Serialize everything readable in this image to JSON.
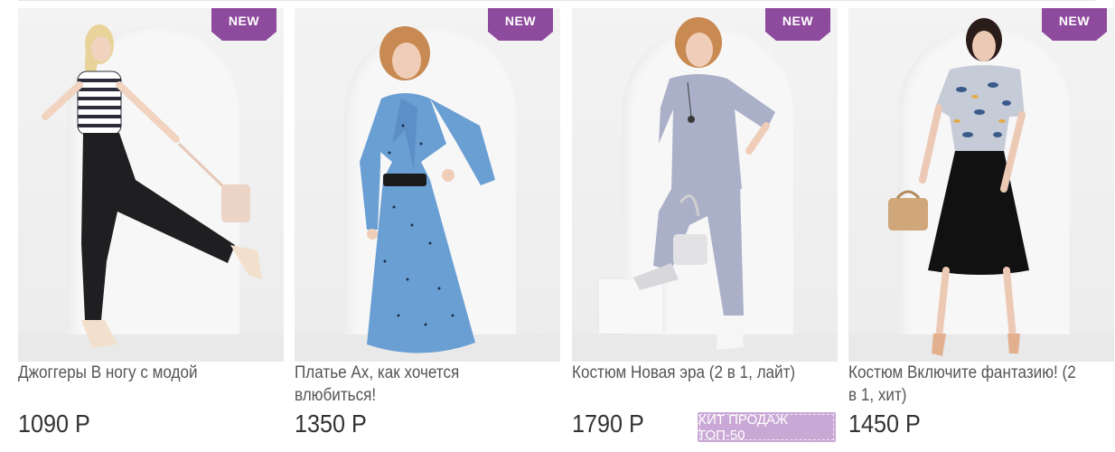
{
  "products": [
    {
      "badge": "NEW",
      "title": "Джоггеры В ногу с модой",
      "price": "1090 Р",
      "image_desc": "model-in-black-joggers-striped-top"
    },
    {
      "badge": "NEW",
      "title": "Платье Ах, как хочется влюбиться!",
      "price": "1350 Р",
      "image_desc": "model-in-blue-polka-dot-dress"
    },
    {
      "badge": "NEW",
      "title": "Костюм Новая эра (2 в 1, лайт)",
      "price": "1790 Р",
      "hit_badge": "ХИТ ПРОДАЖ ТОП-50",
      "image_desc": "model-in-grey-two-piece-suit"
    },
    {
      "badge": "NEW",
      "title": "Костюм Включите фантазию! (2 в 1, хит)",
      "price": "1450 Р",
      "image_desc": "model-in-floral-top-black-skirt"
    }
  ],
  "colors": {
    "badge_bg": "#8e4a9c",
    "hit_badge_bg": "#c9a8d6",
    "title_text": "#555555",
    "price_text": "#333333"
  }
}
